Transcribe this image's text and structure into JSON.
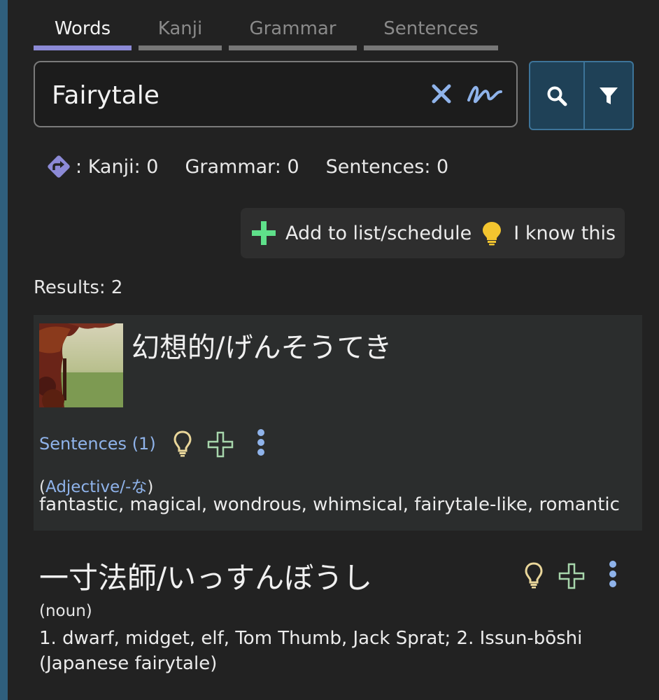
{
  "tabs": [
    {
      "label": "Words",
      "active": true
    },
    {
      "label": "Kanji",
      "active": false
    },
    {
      "label": "Grammar",
      "active": false
    },
    {
      "label": "Sentences",
      "active": false
    }
  ],
  "search": {
    "value": "Fairytale"
  },
  "counts": {
    "kanji": "Kanji: 0",
    "grammar": "Grammar: 0",
    "sentences": "Sentences: 0",
    "prefix": ":"
  },
  "actions": {
    "add_label": "Add to list/schedule",
    "know_label": "I know this"
  },
  "results_label": "Results: 2",
  "results": [
    {
      "word": "幻想的/げんそうてき",
      "sentences_link": "Sentences (1)",
      "pos_open": "(",
      "pos": "Adjective/-な",
      "pos_close": ")",
      "definition": "fantastic, magical, wondrous, whimsical, fairytale-like, romantic"
    },
    {
      "word": "一寸法師/いっすんぼうし",
      "pos": "(noun)",
      "definition": "1. dwarf, midget, elf, Tom Thumb, Jack Sprat; 2. Issun-bōshi (Japanese fairytale)"
    }
  ],
  "colors": {
    "accent": "#8c8ad6",
    "link": "#8fb3ea",
    "button_bg": "#1f4157",
    "plus": "#5fe08a",
    "bulb": "#f3c52f"
  }
}
